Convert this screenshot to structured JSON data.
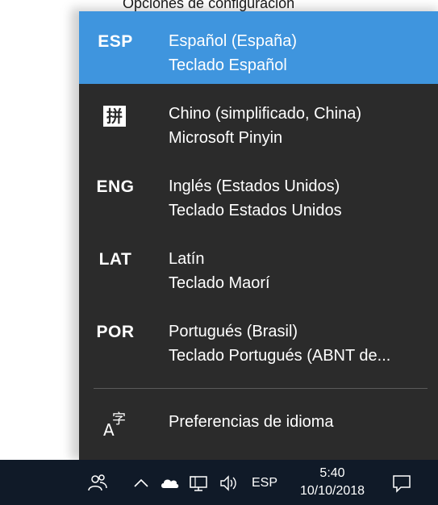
{
  "background": {
    "title": "Opciones de configuración"
  },
  "flyout": {
    "items": [
      {
        "code": "ESP",
        "language": "Español (España)",
        "keyboard": "Teclado Español",
        "selected": true
      },
      {
        "code": "",
        "icon": "pinyin-ime-icon",
        "icon_glyph": "拼",
        "language": "Chino (simplificado, China)",
        "keyboard": "Microsoft Pinyin",
        "selected": false
      },
      {
        "code": "ENG",
        "language": "Inglés (Estados Unidos)",
        "keyboard": "Teclado Estados Unidos",
        "selected": false
      },
      {
        "code": "LAT",
        "language": "Latín",
        "keyboard": "Teclado Maorí",
        "selected": false
      },
      {
        "code": "POR",
        "language": "Portugués (Brasil)",
        "keyboard": "Teclado Portugués (ABNT de...",
        "selected": false
      }
    ],
    "preferences_label": "Preferencias de idioma"
  },
  "taskbar": {
    "language": "ESP",
    "time": "5:40",
    "date": "10/10/2018",
    "icons": [
      "people-icon",
      "chevron-up-icon",
      "onedrive-cloud-icon",
      "network-icon",
      "volume-icon",
      "action-center-icon"
    ]
  },
  "colors": {
    "flyout_bg": "#2b2b2b",
    "selected_bg": "#3f95de",
    "taskbar_bg": "#101a28"
  }
}
